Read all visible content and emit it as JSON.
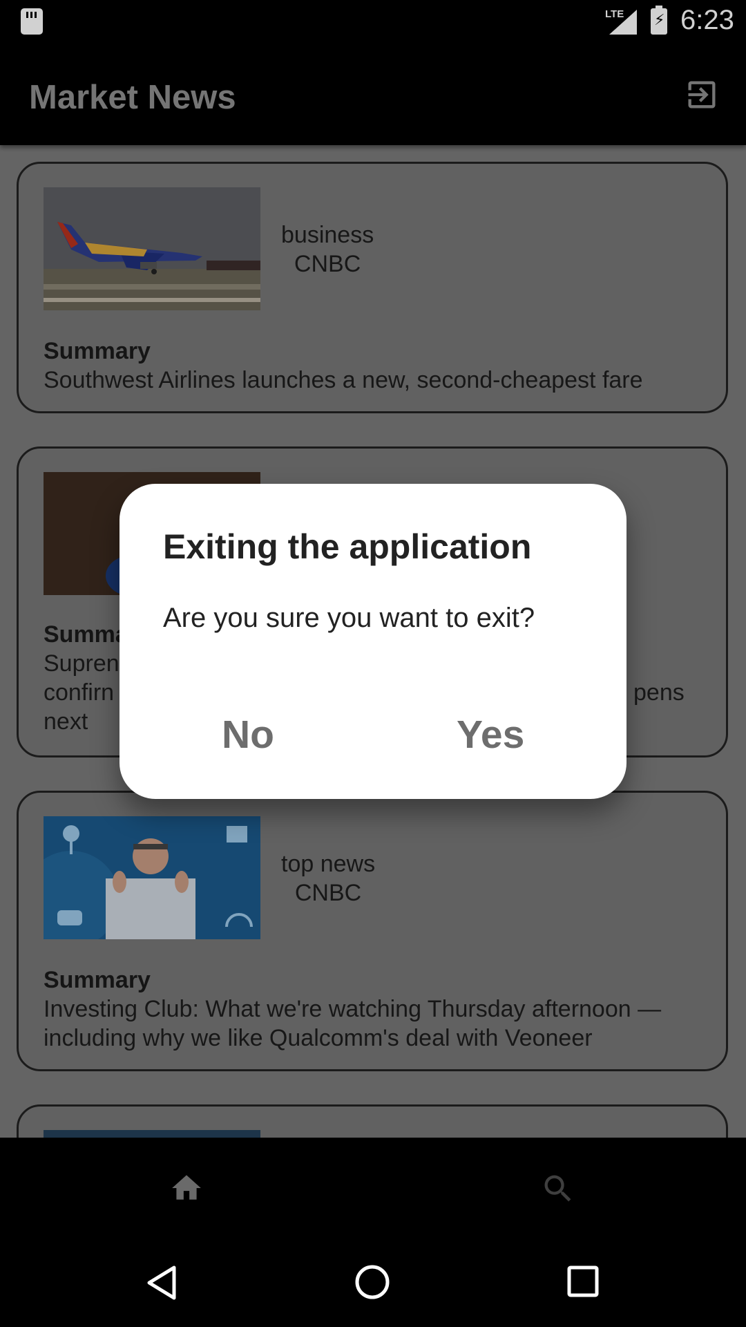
{
  "status_bar": {
    "network": "LTE",
    "time": "6:23"
  },
  "app_bar": {
    "title": "Market News",
    "exit_icon": "exit-to-app-icon"
  },
  "articles": [
    {
      "category": "business",
      "source": "CNBC",
      "summary_label": "Summary",
      "summary": "Southwest Airlines launches a new, second-cheapest fare"
    },
    {
      "category": "",
      "source": "",
      "summary_label": "Summa",
      "summary_lines": [
        "Supren",
        "confirn",
        "next"
      ],
      "summary_tail": "pens"
    },
    {
      "category": "top news",
      "source": "CNBC",
      "summary_label": "Summary",
      "summary": "Investing Club: What we're watching Thursday afternoon — including why we like Qualcomm's deal with Veoneer"
    }
  ],
  "dialog": {
    "title": "Exiting the application",
    "message": "Are you sure you want to exit?",
    "no_label": "No",
    "yes_label": "Yes"
  },
  "bottom_nav": {
    "items": [
      "home-icon",
      "search-icon"
    ]
  },
  "system_nav": [
    "back-icon",
    "home-circle-icon",
    "recents-icon"
  ],
  "colors": {
    "app_bar_bg": "#000000",
    "dialog_bg": "#ffffff",
    "button_text": "#6d6d6d"
  }
}
